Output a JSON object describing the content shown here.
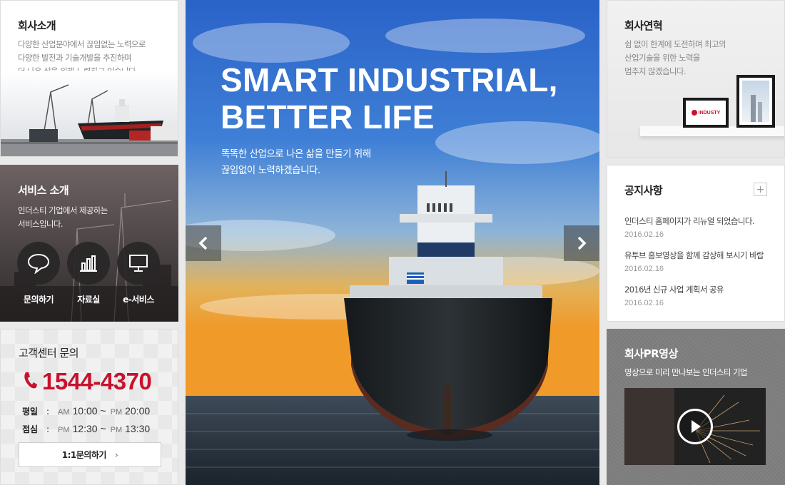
{
  "intro": {
    "title": "회사소개",
    "desc": [
      "다양한 산업분야에서 끊임없는 노력으로",
      "다양한 발전과 기술개발을 추진하며",
      "더 나은 삶을 위해 노력하고 있습니다."
    ]
  },
  "services": {
    "title": "서비스 소개",
    "desc": [
      "인더스티 기업에서 제공하는",
      "서비스입니다."
    ],
    "items": [
      {
        "label": "문의하기",
        "icon": "chat-bubble-icon"
      },
      {
        "label": "자료실",
        "icon": "bar-chart-icon"
      },
      {
        "label": "e-서비스",
        "icon": "monitor-icon"
      }
    ]
  },
  "cs": {
    "title": "고객센터 문의",
    "phone": "1544-4370",
    "hours": [
      {
        "label": "평일",
        "sep": ":",
        "from_ampm": "AM",
        "from": "10:00 ~",
        "to_ampm": "PM",
        "to": "20:00"
      },
      {
        "label": "점심",
        "sep": ":",
        "from_ampm": "PM",
        "from": "12:30 ~",
        "to_ampm": "PM",
        "to": "13:30"
      }
    ],
    "button": "1:1문의하기",
    "button_arrow": "›",
    "accent": "#c8122d"
  },
  "hero": {
    "title": [
      "SMART INDUSTRIAL,",
      "BETTER LIFE"
    ],
    "subtitle": [
      "똑똑한 산업으로 나은 삶을 만들기 위해",
      "끊임없이 노력하겠습니다."
    ],
    "prev_icon": "chevron-left-icon",
    "next_icon": "chevron-right-icon"
  },
  "history": {
    "title": "회사연혁",
    "desc": [
      "쉼 없이 한계에 도전하며 최고의",
      "산업기술을 위한 노력을",
      "멈추지 않겠습니다."
    ],
    "frame_logo": "INDUSTY"
  },
  "notice": {
    "title": "공지사항",
    "more": "+",
    "items": [
      {
        "title": "인더스티 홈페이지가 리뉴얼 되었습니다.",
        "date": "2016.02.16"
      },
      {
        "title": "유투브 홍보영상을 함께 감상해 보시기 바랍",
        "date": "2016.02.16"
      },
      {
        "title": "2016년 신규 사업 계획서 공유",
        "date": "2016.02.16"
      }
    ]
  },
  "pr": {
    "title": "회사PR영상",
    "desc": "영상으로 미리 만나보는 인더스티 기업"
  }
}
